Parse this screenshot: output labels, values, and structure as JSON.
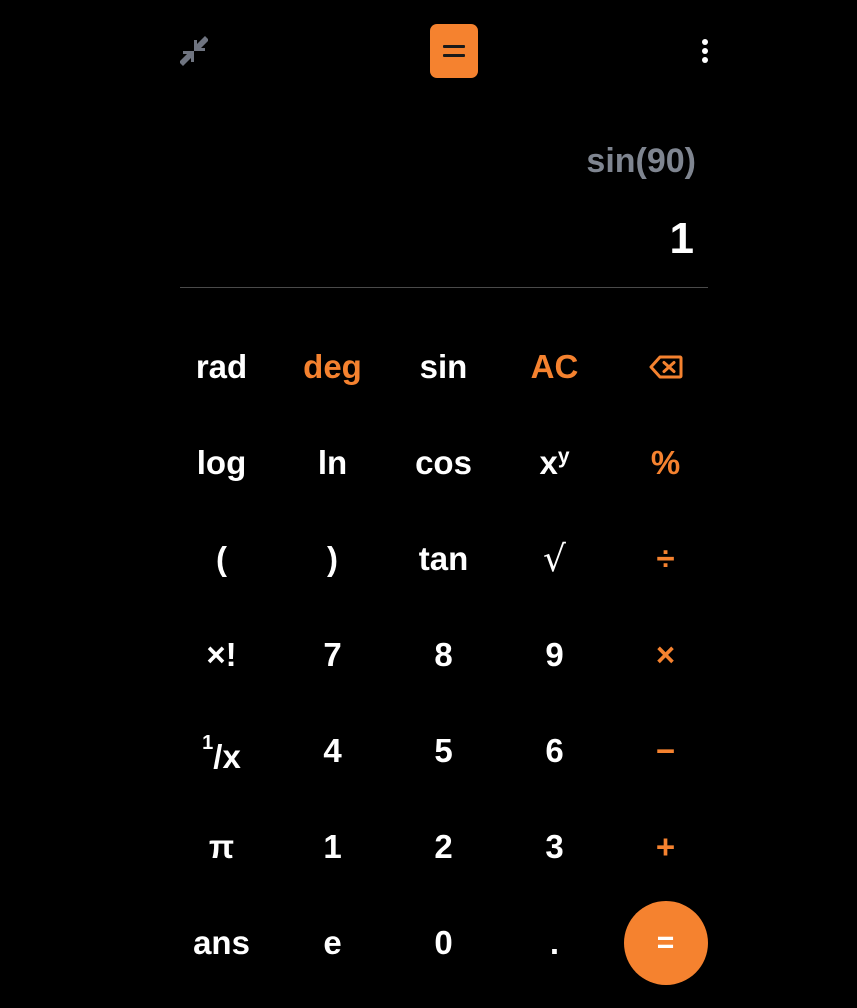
{
  "topbar": {
    "minimize_icon": "minimize-arrows-icon",
    "equals_tab_icon": "equals-icon",
    "menu_icon": "more-vertical-icon"
  },
  "display": {
    "expression": "sin(90)",
    "result": "1"
  },
  "keypad": {
    "rad": "rad",
    "deg": "deg",
    "sin": "sin",
    "ac": "AC",
    "backspace_icon": "backspace-icon",
    "log": "log",
    "ln": "ln",
    "cos": "cos",
    "power_base": "x",
    "power_exp": "y",
    "percent": "%",
    "open_paren": "(",
    "close_paren": ")",
    "tan": "tan",
    "sqrt": "√",
    "divide": "÷",
    "factorial": "×!",
    "seven": "7",
    "eight": "8",
    "nine": "9",
    "multiply": "×",
    "recip_num": "1",
    "recip_den": "/x",
    "four": "4",
    "five": "5",
    "six": "6",
    "minus": "−",
    "pi": "π",
    "one": "1",
    "two": "2",
    "three": "3",
    "plus": "+",
    "ans": "ans",
    "e": "e",
    "zero": "0",
    "dot": ".",
    "equals": "="
  },
  "colors": {
    "accent": "#f5822f",
    "background": "#000000",
    "text": "#ffffff",
    "expression_text": "#7f8590",
    "divider": "#4a4a4a"
  }
}
